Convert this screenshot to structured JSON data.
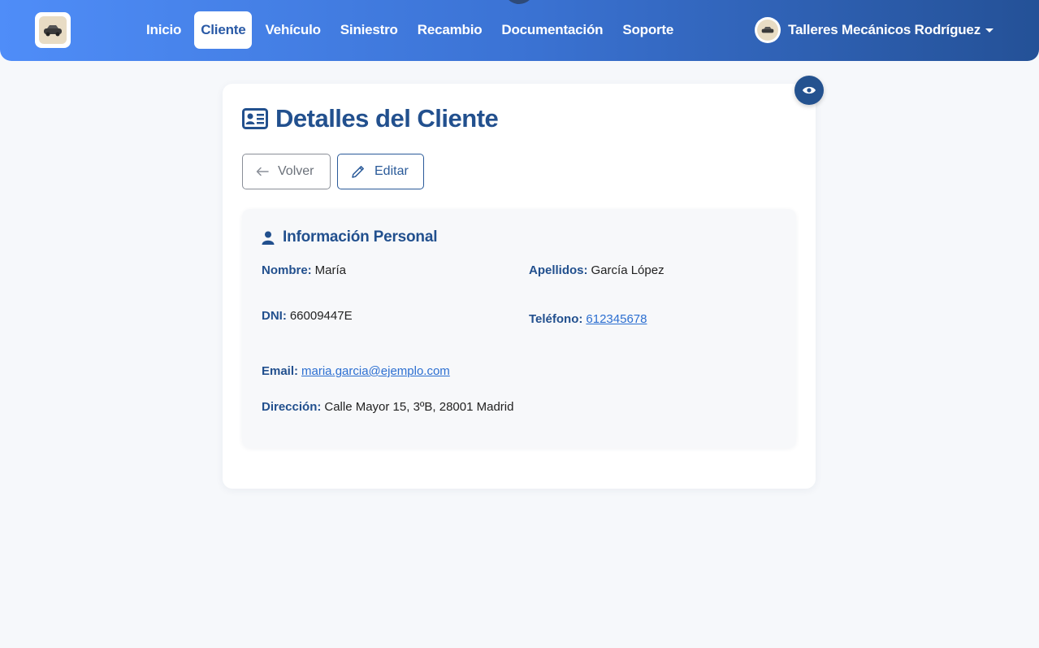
{
  "nav": {
    "brand_icon": "garage-logo-icon",
    "links": [
      {
        "label": "Inicio",
        "active": false
      },
      {
        "label": "Cliente",
        "active": true
      },
      {
        "label": "Vehículo",
        "active": false
      },
      {
        "label": "Siniestro",
        "active": false
      },
      {
        "label": "Recambio",
        "active": false
      },
      {
        "label": "Documentación",
        "active": false
      },
      {
        "label": "Soporte",
        "active": false
      }
    ],
    "user_name": "Talleres Mecánicos Rodríguez"
  },
  "page": {
    "title": "Detalles del Cliente",
    "back_label": "Volver",
    "edit_label": "Editar"
  },
  "personal": {
    "section_title": "Información Personal",
    "nombre_label": "Nombre:",
    "nombre": "María",
    "apellidos_label": "Apellidos:",
    "apellidos": "García López",
    "dni_label": "DNI:",
    "dni": "66009447E",
    "telefono_label": "Teléfono:",
    "telefono": "612345678",
    "email_label": "Email:",
    "email": "maria.garcia@ejemplo.com",
    "direccion_label": "Dirección:",
    "direccion": "Calle Mayor 15, 3ºB, 28001 Madrid"
  },
  "colors": {
    "primary": "#22508e",
    "nav_gradient_start": "#4f8df8",
    "nav_gradient_end": "#245197",
    "link": "#2c6fd1"
  }
}
